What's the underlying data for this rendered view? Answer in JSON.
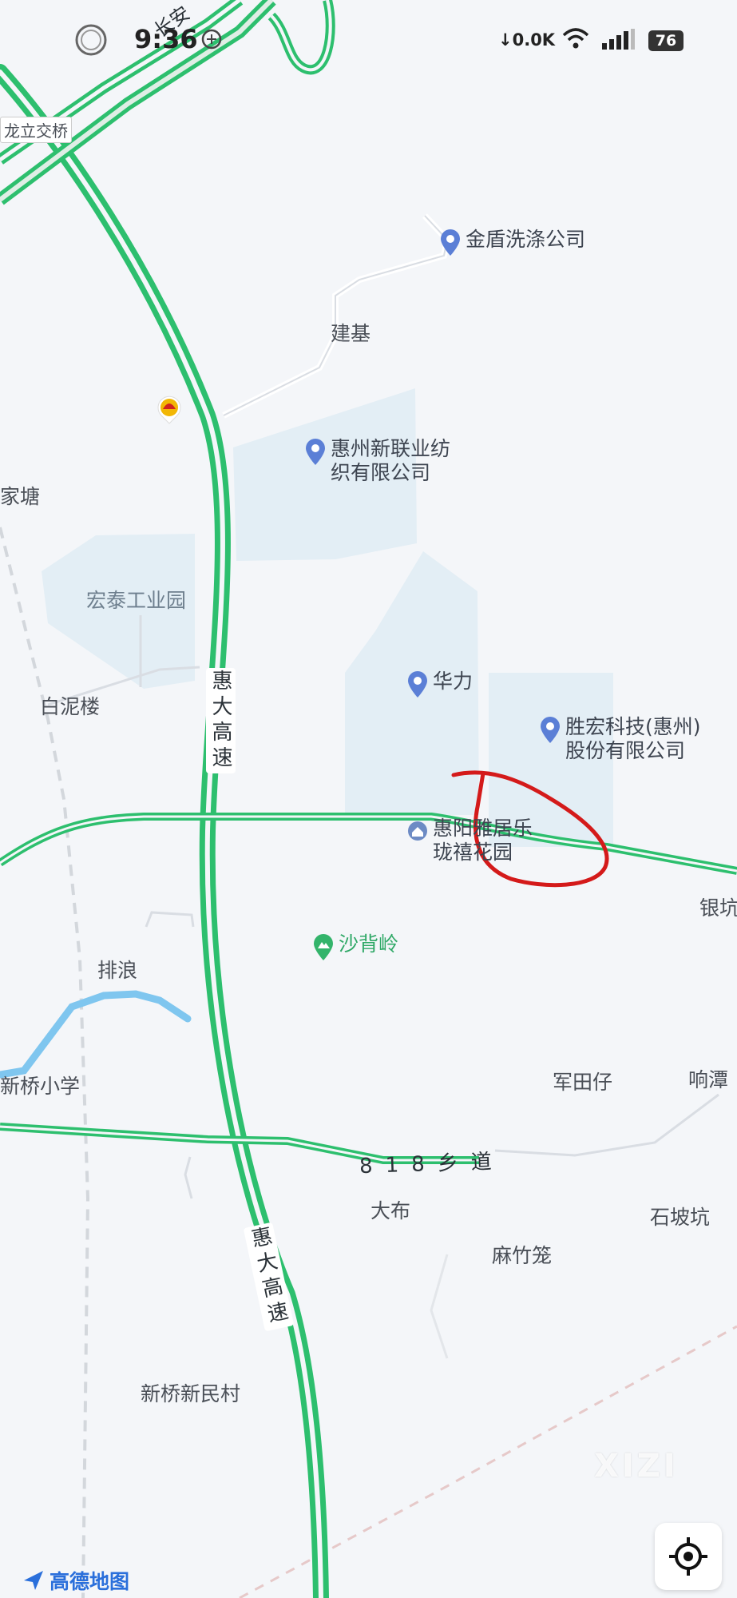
{
  "status_bar": {
    "time": "9:36",
    "network_speed": "0.0K",
    "battery": "76"
  },
  "map": {
    "highway_name": "惠大高速",
    "highway_name_top": "长安",
    "interchange_label": "龙立交桥",
    "township_road": "818乡道",
    "road_label_right": "银坑",
    "road_label_right2": "响潭",
    "places": [
      "家塘",
      "建基",
      "宏泰工业园",
      "白泥楼",
      "排浪",
      "新桥小学",
      "军田仔",
      "大布",
      "石坡坑",
      "麻竹笼",
      "新桥新民村"
    ],
    "pois": [
      {
        "name": "金盾洗涤公司",
        "icon": "pin-icon"
      },
      {
        "name": "惠州新联业纺\n织有限公司",
        "icon": "pin-icon"
      },
      {
        "name": "华力",
        "icon": "pin-icon"
      },
      {
        "name": "胜宏科技(惠州)\n股份有限公司",
        "icon": "pin-icon"
      },
      {
        "name": "惠阳雅居乐\n珑禧花园",
        "icon": "residence-icon"
      },
      {
        "name": "沙背岭",
        "icon": "mountain-icon"
      }
    ],
    "colors": {
      "highway": "#2dbf6e",
      "river": "#7fc6ef",
      "block": "#e3eef5",
      "annotation": "#d41a1a"
    }
  },
  "brand": "高德地图",
  "watermark": "XIZI"
}
